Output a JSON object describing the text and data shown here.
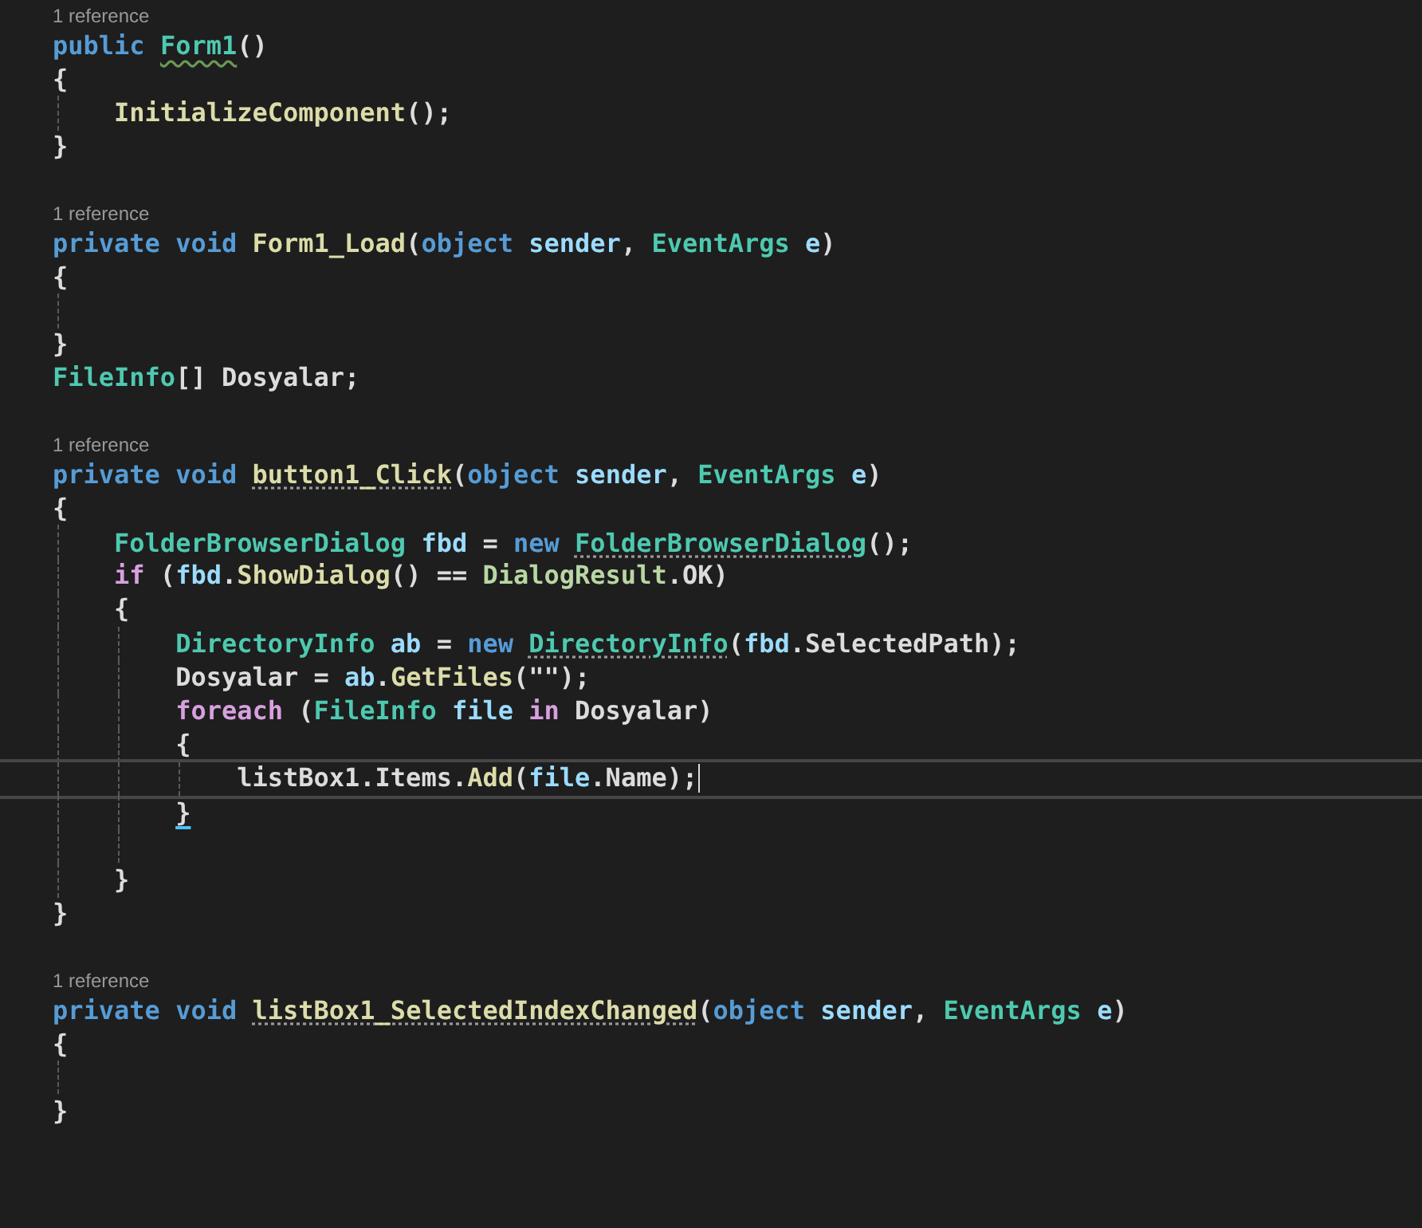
{
  "editor": {
    "lines": [
      {
        "kind": "reference",
        "text": "1 reference"
      },
      {
        "kind": "code",
        "current": false,
        "tokens": [
          {
            "text": "public ",
            "color": "#569cd6"
          },
          {
            "text": "Form1",
            "color": "#4ec9b0",
            "squiggle": true
          },
          {
            "text": "()",
            "color": "#dcdcdc"
          }
        ]
      },
      {
        "kind": "code",
        "current": false,
        "tokens": [
          {
            "text": "{",
            "color": "#dcdcdc"
          }
        ]
      },
      {
        "kind": "code",
        "current": false,
        "tokens": [
          {
            "text": "    InitializeComponent",
            "color": "#dcdcaa"
          },
          {
            "text": "();",
            "color": "#dcdcdc"
          }
        ]
      },
      {
        "kind": "code",
        "current": false,
        "tokens": [
          {
            "text": "}",
            "color": "#dcdcdc"
          }
        ]
      },
      {
        "kind": "blank"
      },
      {
        "kind": "reference",
        "text": "1 reference"
      },
      {
        "kind": "code",
        "current": false,
        "tokens": [
          {
            "text": "private void ",
            "color": "#569cd6"
          },
          {
            "text": "Form1_Load",
            "color": "#dcdcaa"
          },
          {
            "text": "(",
            "color": "#dcdcdc"
          },
          {
            "text": "object ",
            "color": "#569cd6"
          },
          {
            "text": "sender",
            "color": "#9cdcfe"
          },
          {
            "text": ", ",
            "color": "#dcdcdc"
          },
          {
            "text": "EventArgs ",
            "color": "#4ec9b0"
          },
          {
            "text": "e",
            "color": "#9cdcfe"
          },
          {
            "text": ")",
            "color": "#dcdcdc"
          }
        ]
      },
      {
        "kind": "code",
        "current": false,
        "tokens": [
          {
            "text": "{",
            "color": "#dcdcdc"
          }
        ]
      },
      {
        "kind": "blank"
      },
      {
        "kind": "code",
        "current": false,
        "tokens": [
          {
            "text": "}",
            "color": "#dcdcdc"
          }
        ]
      },
      {
        "kind": "code",
        "current": false,
        "tokens": [
          {
            "text": "FileInfo",
            "color": "#4ec9b0"
          },
          {
            "text": "[] Dosyalar;",
            "color": "#dcdcdc"
          }
        ]
      },
      {
        "kind": "blank"
      },
      {
        "kind": "reference",
        "text": "1 reference"
      },
      {
        "kind": "code",
        "current": false,
        "tokens": [
          {
            "text": "private void ",
            "color": "#569cd6"
          },
          {
            "text": "button1_Click",
            "color": "#dcdcaa",
            "dotted": true
          },
          {
            "text": "(",
            "color": "#dcdcdc"
          },
          {
            "text": "object ",
            "color": "#569cd6"
          },
          {
            "text": "sender",
            "color": "#9cdcfe"
          },
          {
            "text": ", ",
            "color": "#dcdcdc"
          },
          {
            "text": "EventArgs ",
            "color": "#4ec9b0"
          },
          {
            "text": "e",
            "color": "#9cdcfe"
          },
          {
            "text": ")",
            "color": "#dcdcdc"
          }
        ]
      },
      {
        "kind": "code",
        "current": false,
        "tokens": [
          {
            "text": "{",
            "color": "#dcdcdc"
          }
        ]
      },
      {
        "kind": "code",
        "current": false,
        "tokens": [
          {
            "text": "    FolderBrowserDialog ",
            "color": "#4ec9b0"
          },
          {
            "text": "fbd",
            "color": "#9cdcfe"
          },
          {
            "text": " = ",
            "color": "#dcdcdc"
          },
          {
            "text": "new ",
            "color": "#569cd6"
          },
          {
            "text": "FolderBrowserDialog",
            "color": "#4ec9b0",
            "dotted": true
          },
          {
            "text": "();",
            "color": "#dcdcdc"
          }
        ]
      },
      {
        "kind": "code",
        "current": false,
        "tokens": [
          {
            "text": "    if",
            "color": "#d8a0df"
          },
          {
            "text": " (",
            "color": "#dcdcdc"
          },
          {
            "text": "fbd",
            "color": "#9cdcfe"
          },
          {
            "text": ".",
            "color": "#dcdcdc"
          },
          {
            "text": "ShowDialog",
            "color": "#dcdcaa"
          },
          {
            "text": "() == ",
            "color": "#dcdcdc"
          },
          {
            "text": "DialogResult",
            "color": "#b8d7a3"
          },
          {
            "text": ".OK)",
            "color": "#dcdcdc"
          }
        ]
      },
      {
        "kind": "code",
        "current": false,
        "tokens": [
          {
            "text": "    {",
            "color": "#dcdcdc"
          }
        ]
      },
      {
        "kind": "code",
        "current": false,
        "tokens": [
          {
            "text": "        DirectoryInfo ",
            "color": "#4ec9b0"
          },
          {
            "text": "ab",
            "color": "#9cdcfe"
          },
          {
            "text": " = ",
            "color": "#dcdcdc"
          },
          {
            "text": "new ",
            "color": "#569cd6"
          },
          {
            "text": "DirectoryInfo",
            "color": "#4ec9b0",
            "dotted": true
          },
          {
            "text": "(",
            "color": "#dcdcdc"
          },
          {
            "text": "fbd",
            "color": "#9cdcfe"
          },
          {
            "text": ".SelectedPath);",
            "color": "#dcdcdc"
          }
        ]
      },
      {
        "kind": "code",
        "current": false,
        "tokens": [
          {
            "text": "        Dosyalar = ",
            "color": "#dcdcdc"
          },
          {
            "text": "ab",
            "color": "#9cdcfe"
          },
          {
            "text": ".",
            "color": "#dcdcdc"
          },
          {
            "text": "GetFiles",
            "color": "#dcdcaa"
          },
          {
            "text": "(\"\");",
            "color": "#dcdcdc"
          }
        ]
      },
      {
        "kind": "code",
        "current": false,
        "tokens": [
          {
            "text": "        foreach",
            "color": "#d8a0df"
          },
          {
            "text": " (",
            "color": "#dcdcdc"
          },
          {
            "text": "FileInfo ",
            "color": "#4ec9b0"
          },
          {
            "text": "file ",
            "color": "#9cdcfe"
          },
          {
            "text": "in",
            "color": "#d8a0df"
          },
          {
            "text": " Dosyalar)",
            "color": "#dcdcdc"
          }
        ]
      },
      {
        "kind": "code",
        "current": false,
        "tokens": [
          {
            "text": "        {",
            "color": "#dcdcdc"
          }
        ]
      },
      {
        "kind": "code",
        "current": true,
        "tokens": [
          {
            "text": "            listBox1.Items.",
            "color": "#dcdcdc"
          },
          {
            "text": "Add",
            "color": "#dcdcaa"
          },
          {
            "text": "(",
            "color": "#dcdcdc"
          },
          {
            "text": "file",
            "color": "#9cdcfe"
          },
          {
            "text": ".Name);",
            "color": "#dcdcdc"
          }
        ]
      },
      {
        "kind": "code",
        "current": false,
        "tokens": [
          {
            "text": "        }",
            "color": "#dcdcdc",
            "underlined": true
          }
        ]
      },
      {
        "kind": "blank"
      },
      {
        "kind": "code",
        "current": false,
        "tokens": [
          {
            "text": "    }",
            "color": "#dcdcdc"
          }
        ]
      },
      {
        "kind": "code",
        "current": false,
        "tokens": [
          {
            "text": "}",
            "color": "#dcdcdc"
          }
        ]
      },
      {
        "kind": "blank"
      },
      {
        "kind": "reference",
        "text": "1 reference"
      },
      {
        "kind": "code",
        "current": false,
        "tokens": [
          {
            "text": "private void ",
            "color": "#569cd6"
          },
          {
            "text": "listBox1_SelectedIndexChanged",
            "color": "#dcdcaa",
            "dotted": true
          },
          {
            "text": "(",
            "color": "#dcdcdc"
          },
          {
            "text": "object ",
            "color": "#569cd6"
          },
          {
            "text": "sender",
            "color": "#9cdcfe"
          },
          {
            "text": ", ",
            "color": "#dcdcdc"
          },
          {
            "text": "EventArgs ",
            "color": "#4ec9b0"
          },
          {
            "text": "e",
            "color": "#9cdcfe"
          },
          {
            "text": ")",
            "color": "#dcdcdc"
          }
        ]
      },
      {
        "kind": "code",
        "current": false,
        "tokens": [
          {
            "text": "{",
            "color": "#dcdcdc"
          }
        ]
      },
      {
        "kind": "blank"
      },
      {
        "kind": "code",
        "current": false,
        "tokens": [
          {
            "text": "}",
            "color": "#dcdcdc"
          }
        ]
      }
    ]
  }
}
